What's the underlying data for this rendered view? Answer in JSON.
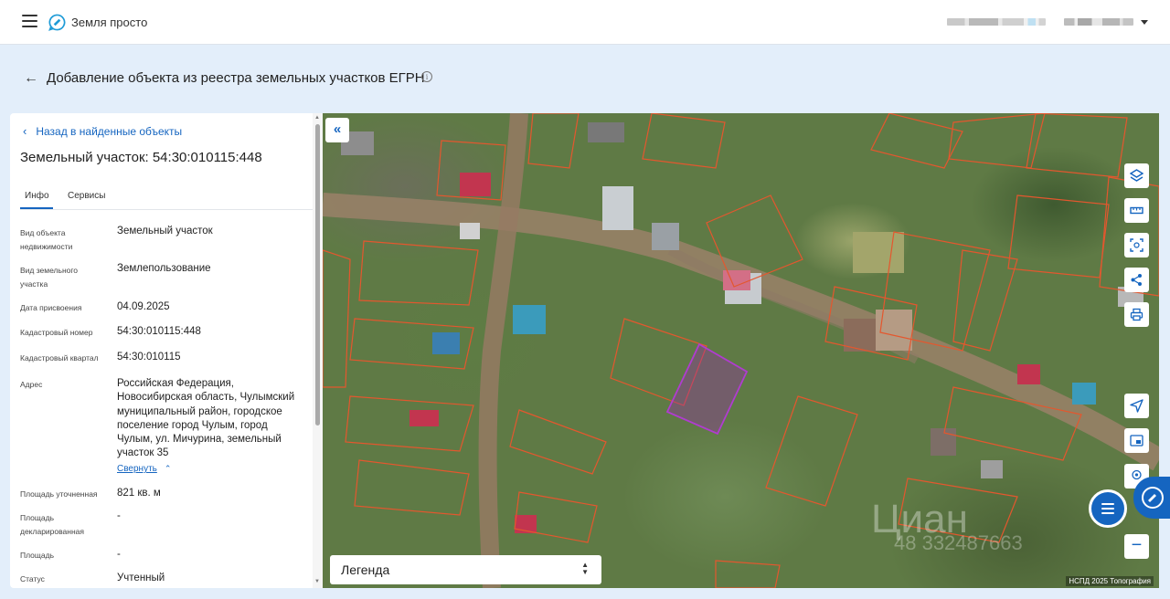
{
  "app": {
    "title": "Земля просто"
  },
  "page": {
    "title": "Добавление объекта из реестра земельных участков ЕГРН",
    "info_icon": "i"
  },
  "panel": {
    "back_link": "Назад в найденные объекты",
    "object_title": "Земельный участок: 54:30:010115:448",
    "tabs": [
      {
        "label": "Инфо",
        "active": true
      },
      {
        "label": "Сервисы",
        "active": false
      }
    ],
    "fields": [
      {
        "label": "Вид объекта недвижимости",
        "value": "Земельный участок"
      },
      {
        "label": "Вид земельного участка",
        "value": "Землепользование"
      },
      {
        "label": "Дата присвоения",
        "value": "04.09.2025"
      },
      {
        "label": "Кадастровый номер",
        "value": "54:30:010115:448"
      },
      {
        "label": "Кадастровый квартал",
        "value": "54:30:010115"
      },
      {
        "label": "Адрес",
        "value": "Российская Федерация, Новосибирская область, Чулымский муниципальный район, городское поселение город Чулым, город Чулым, ул. Мичурина, земельный участок 35"
      },
      {
        "label": "Площадь уточненная",
        "value": "821 кв. м"
      },
      {
        "label": "Площадь декларированная",
        "value": "-"
      },
      {
        "label": "Площадь",
        "value": "-"
      },
      {
        "label": "Статус",
        "value": "Учтенный"
      }
    ],
    "collapse_label": "Свернуть"
  },
  "map": {
    "legend_label": "Легенда",
    "attribution": "НСПД 2025 Топография",
    "watermark_text": "Циан",
    "watermark_phone": "48 332487663",
    "controls": [
      "layers-icon",
      "ruler-icon",
      "select-area-icon",
      "share-icon",
      "print-icon",
      "locate-icon",
      "minimap-icon",
      "pin-icon"
    ],
    "zoom_out_label": "−"
  },
  "colors": {
    "accent": "#1565c0",
    "selected_parcel": "#9c27b0",
    "parcel_border": "#e4572e"
  }
}
